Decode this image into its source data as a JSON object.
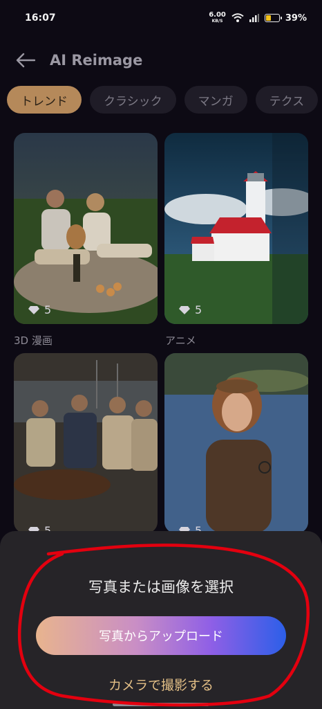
{
  "status_bar": {
    "time": "16:07",
    "net_speed": "6.00",
    "net_unit": "KB/S",
    "battery_percent": "39%",
    "battery_level": 0.39
  },
  "header": {
    "title": "AI Reimage"
  },
  "tabs": [
    {
      "label": "トレンド",
      "active": true
    },
    {
      "label": "クラシック",
      "active": false
    },
    {
      "label": "マンガ",
      "active": false
    },
    {
      "label": "テクス",
      "active": false
    }
  ],
  "cards": [
    {
      "label": "3D 漫画",
      "likes": "5"
    },
    {
      "label": "アニメ",
      "likes": "5"
    },
    {
      "label": "",
      "likes": "5"
    },
    {
      "label": "",
      "likes": "5"
    }
  ],
  "sheet": {
    "title": "写真または画像を選択",
    "upload_label": "写真からアップロード",
    "camera_label": "カメラで撮影する"
  },
  "colors": {
    "accent_tab": "#b5895a",
    "camera_link": "#e3bf86",
    "annotation": "#e3000f"
  }
}
